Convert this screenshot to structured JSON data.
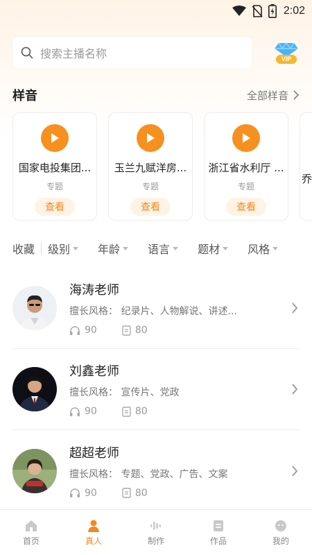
{
  "status_bar": {
    "time": "2:02"
  },
  "search": {
    "placeholder": "搜索主播名称"
  },
  "vip": {
    "label": "VIP"
  },
  "samples": {
    "title": "样音",
    "more": "全部样音",
    "cards": [
      {
        "title": "国家电投集团...",
        "tag": "专题",
        "button": "查看"
      },
      {
        "title": "玉兰九赋洋房...",
        "tag": "专题",
        "button": "查看"
      },
      {
        "title": "浙江省水利厅 ...",
        "tag": "专题",
        "button": "查看"
      },
      {
        "title": "乔"
      }
    ]
  },
  "filters": {
    "favorites": "收藏",
    "items": [
      "级别",
      "年龄",
      "语言",
      "题材",
      "风格"
    ]
  },
  "teachers": [
    {
      "name": "海涛老师",
      "style": "擅长风格： 纪录片、人物解说、讲述...",
      "plays": "90",
      "works": "80"
    },
    {
      "name": "刘鑫老师",
      "style": "擅长风格： 宣传片、党政",
      "plays": "90",
      "works": "80"
    },
    {
      "name": "超超老师",
      "style": "擅长风格： 专题、党政、广告、文案",
      "plays": "90",
      "works": "80"
    }
  ],
  "nav": [
    {
      "label": "首页",
      "icon": "home-icon"
    },
    {
      "label": "真人",
      "icon": "person-icon",
      "active": true
    },
    {
      "label": "制作",
      "icon": "waveform-icon"
    },
    {
      "label": "作品",
      "icon": "document-icon"
    },
    {
      "label": "我的",
      "icon": "profile-icon"
    }
  ],
  "colors": {
    "accent": "#f6901e",
    "accent_text": "#f08a1d",
    "accent_bg": "#fff3e5"
  }
}
